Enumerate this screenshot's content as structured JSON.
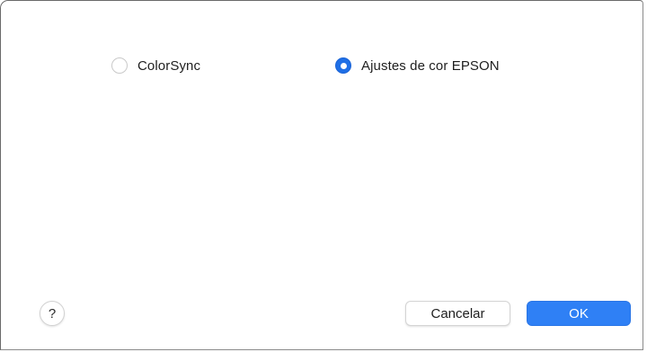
{
  "dialog": {
    "color_mode": {
      "options": [
        {
          "label": "ColorSync",
          "selected": false
        },
        {
          "label": "Ajustes de cor EPSON",
          "selected": true
        }
      ]
    },
    "help_label": "?",
    "buttons": {
      "cancel_label": "Cancelar",
      "ok_label": "OK"
    }
  },
  "colors": {
    "accent": "#2f80f5",
    "radio_selected": "#1f6fe6",
    "border": "#6a6a6a",
    "text": "#1e1e1e"
  },
  "icons": {
    "help": "question-mark-icon"
  }
}
